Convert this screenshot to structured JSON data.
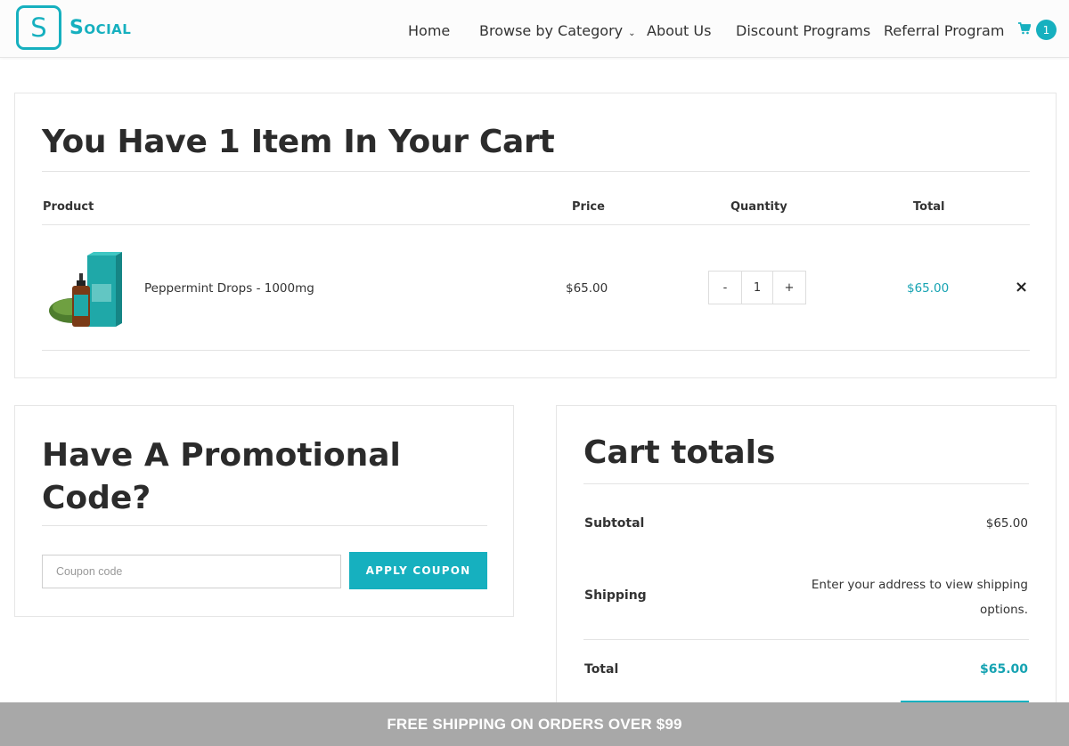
{
  "brand": {
    "logo_letter": "S",
    "name": "Social",
    "accent_color": "#16b0bf"
  },
  "nav": {
    "items": [
      {
        "label": "Home"
      },
      {
        "label": "Browse by Category"
      },
      {
        "label": "About Us"
      },
      {
        "label": "Discount Programs"
      },
      {
        "label": "Referral Program"
      }
    ],
    "cart_icon": "shopping-cart-icon",
    "cart_count": "1"
  },
  "cart": {
    "title": "You Have 1 Item In Your Cart",
    "columns": {
      "product": "Product",
      "price": "Price",
      "quantity": "Quantity",
      "total": "Total"
    },
    "items": [
      {
        "name": "Peppermint Drops - 1000mg",
        "price": "$65.00",
        "qty_minus": "-",
        "quantity": "1",
        "qty_plus": "+",
        "total": "$65.00",
        "remove": "×"
      }
    ]
  },
  "promo": {
    "title": "Have A Promotional Code?",
    "input_placeholder": "Coupon code",
    "button_label": "APPLY COUPON"
  },
  "totals": {
    "title": "Cart totals",
    "subtotal_label": "Subtotal",
    "subtotal_value": "$65.00",
    "shipping_label": "Shipping",
    "shipping_message": "Enter your address to view shipping options.",
    "total_label": "Total",
    "total_value": "$65.00"
  },
  "banner": {
    "text": "FREE SHIPPING ON ORDERS OVER $99"
  }
}
